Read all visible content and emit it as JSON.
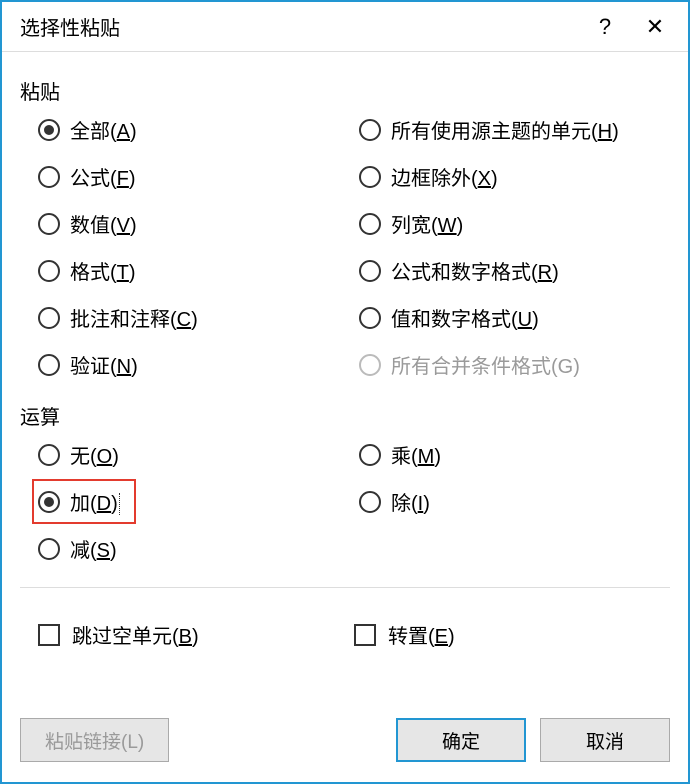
{
  "title": "选择性粘贴",
  "help_symbol": "?",
  "close_symbol": "✕",
  "section_paste": "粘贴",
  "section_operation": "运算",
  "paste_options": {
    "all": {
      "text": "全部",
      "key": "A",
      "selected": true
    },
    "formulas": {
      "text": "公式",
      "key": "F"
    },
    "values": {
      "text": "数值",
      "key": "V"
    },
    "formats": {
      "text": "格式",
      "key": "T"
    },
    "comments": {
      "text": "批注和注释",
      "key": "C"
    },
    "validation": {
      "text": "验证",
      "key": "N"
    },
    "source_theme": {
      "text": "所有使用源主题的单元",
      "key": "H"
    },
    "except_borders": {
      "text": "边框除外",
      "key": "X"
    },
    "col_widths": {
      "text": "列宽",
      "key": "W"
    },
    "formulas_num": {
      "text": "公式和数字格式",
      "key": "R"
    },
    "values_num": {
      "text": "值和数字格式",
      "key": "U"
    },
    "merge_cond": {
      "text": "所有合并条件格式(G)",
      "disabled": true
    }
  },
  "op_options": {
    "none": {
      "text": "无",
      "key": "O"
    },
    "add": {
      "text": "加",
      "key": "D",
      "selected": true,
      "highlighted": true
    },
    "sub": {
      "text": "减",
      "key": "S"
    },
    "mul": {
      "text": "乘",
      "key": "M"
    },
    "div": {
      "text": "除",
      "key": "I"
    }
  },
  "checkboxes": {
    "skip_blanks": {
      "text": "跳过空单元",
      "key": "B"
    },
    "transpose": {
      "text": "转置",
      "key": "E"
    }
  },
  "buttons": {
    "paste_link": "粘贴链接(L)",
    "ok": "确定",
    "cancel": "取消"
  }
}
